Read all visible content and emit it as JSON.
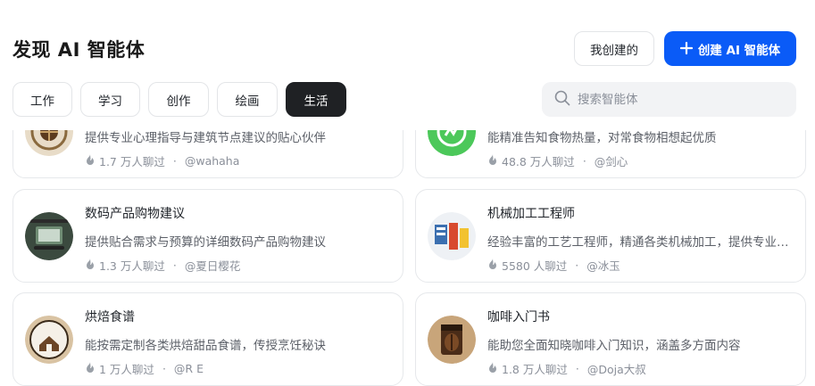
{
  "header": {
    "title": "发现 AI 智能体",
    "my_created_label": "我创建的",
    "create_label": "创建 AI 智能体",
    "create_icon": "plus-icon"
  },
  "tabs": [
    {
      "label": "工作",
      "active": false
    },
    {
      "label": "学习",
      "active": false
    },
    {
      "label": "创作",
      "active": false
    },
    {
      "label": "绘画",
      "active": false
    },
    {
      "label": "生活",
      "active": true
    }
  ],
  "search": {
    "placeholder": "搜索智能体",
    "value": "",
    "icon": "search-icon"
  },
  "colors": {
    "accent": "#0a5bf7",
    "active_tab": "#1f2124"
  },
  "cards": [
    {
      "title": "",
      "description": "提供专业心理指导与建筑节点建议的贴心伙伴",
      "chats": "1.7 万人聊过",
      "author": "@wahaha",
      "icon": "fire-icon"
    },
    {
      "title": "",
      "description": "能精准告知食物热量，对常食物相想起优质",
      "chats": "48.8 万人聊过",
      "author": "@剑心",
      "icon": "fire-icon"
    },
    {
      "title": "数码产品购物建议",
      "description": "提供贴合需求与预算的详细数码产品购物建议",
      "chats": "1.3 万人聊过",
      "author": "@夏日樱花",
      "icon": "fire-icon"
    },
    {
      "title": "机械加工工程师",
      "description": "经验丰富的工艺工程师，精通各类机械加工，提供专业建议",
      "chats": "5580 人聊过",
      "author": "@冰玉",
      "icon": "fire-icon"
    },
    {
      "title": "烘焙食谱",
      "description": "能按需定制各类烘焙甜品食谱，传授烹饪秘诀",
      "chats": "1 万人聊过",
      "author": "@R E",
      "icon": "fire-icon"
    },
    {
      "title": "咖啡入门书",
      "description": "能助您全面知晓咖啡入门知识，涵盖多方面内容",
      "chats": "1.8 万人聊过",
      "author": "@Doja大叔",
      "icon": "fire-icon"
    }
  ]
}
